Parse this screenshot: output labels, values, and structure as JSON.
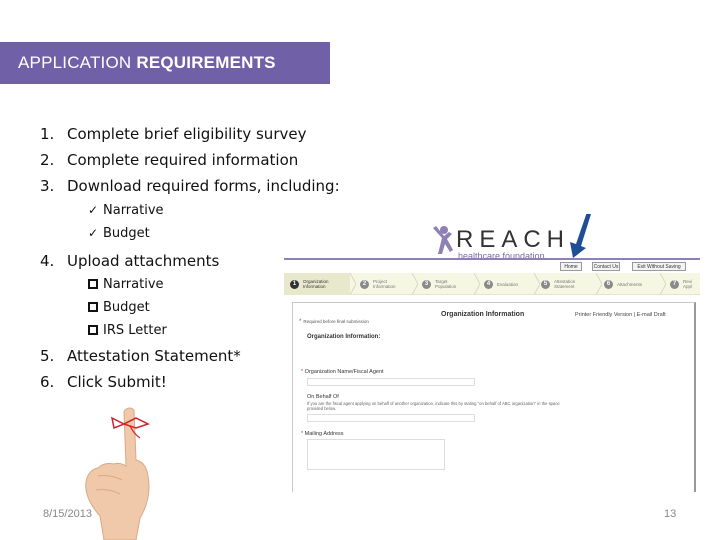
{
  "slide": {
    "title_regular": "APPLICATION",
    "title_bold": "REQUIREMENTS",
    "accent_color": "#7060a8",
    "steps": [
      {
        "num": "1.",
        "text": "Complete brief eligibility survey"
      },
      {
        "num": "2.",
        "text": "Complete required information"
      },
      {
        "num": "3.",
        "text": "Download required forms, including:"
      },
      {
        "num": "4.",
        "text": "Upload attachments"
      },
      {
        "num": "5.",
        "text": "Attestation Statement*"
      },
      {
        "num": "6.",
        "text": "Click Submit!"
      }
    ],
    "download_items": [
      {
        "icon": "check-icon",
        "glyph": "✓",
        "text": "Narrative"
      },
      {
        "icon": "check-icon",
        "glyph": "✓",
        "text": "Budget"
      }
    ],
    "upload_items": [
      {
        "icon": "checkbox-icon",
        "text": "Narrative"
      },
      {
        "icon": "checkbox-icon",
        "text": "Budget"
      },
      {
        "icon": "checkbox-icon",
        "text": "IRS Letter"
      }
    ],
    "footer": {
      "date": "8/15/2013",
      "page": "13"
    }
  },
  "website": {
    "logo_word": "REACH",
    "logo_sub": "healthcare foundation",
    "nav_buttons": [
      "Home",
      "Contact Us",
      "Exit Without Saving"
    ],
    "steps": [
      {
        "num": "1",
        "label": "Organization Information",
        "active": true
      },
      {
        "num": "2",
        "label": "Project Information",
        "active": false
      },
      {
        "num": "3",
        "label": "Target Population",
        "active": false
      },
      {
        "num": "4",
        "label": "Evaluation",
        "active": false
      },
      {
        "num": "5",
        "label": "Attestation Statement",
        "active": false
      },
      {
        "num": "6",
        "label": "Attachments",
        "active": false
      },
      {
        "num": "7",
        "label": "Revi Appl",
        "active": false
      }
    ],
    "form": {
      "title": "Organization Information",
      "links": "Printer Friendly Version | E-mail Draft",
      "required_note": "Required before final submission",
      "section_heading": "Organization Information:",
      "field_org_name": "Organization Name/Fiscal Agent",
      "field_on_behalf": "On Behalf Of",
      "on_behalf_help": "If you are the fiscal agent applying on behalf of another organization, indicate this by stating \"on behalf of ABC organization\" in the space provided below.",
      "field_mailing": "Mailing Address"
    }
  }
}
